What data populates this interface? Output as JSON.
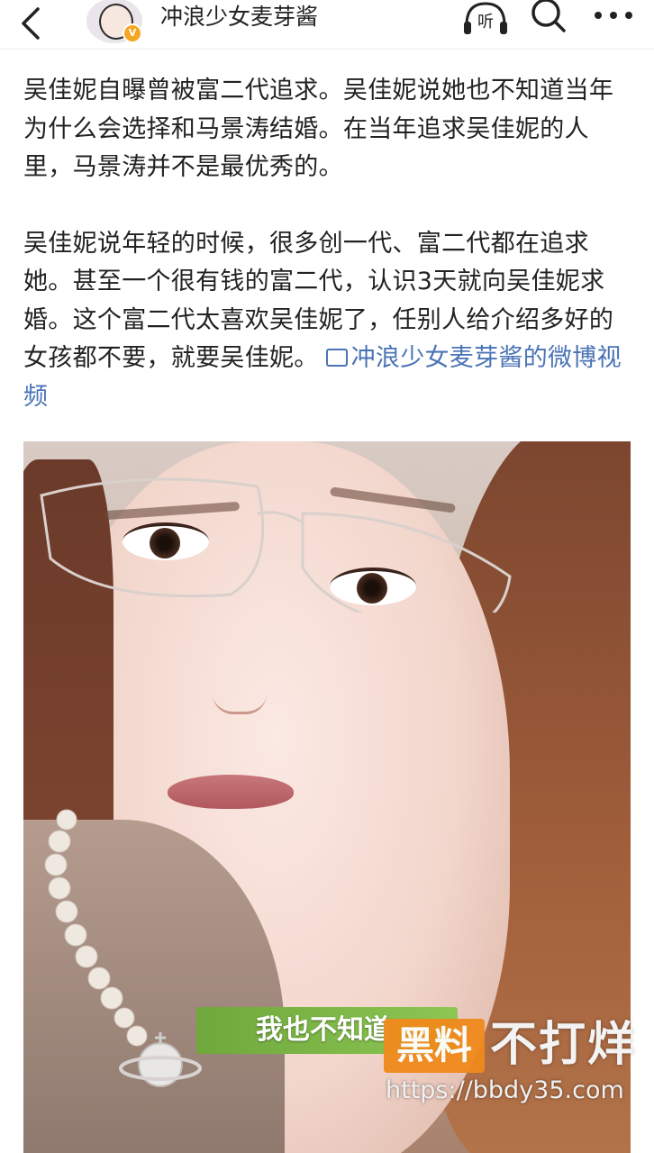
{
  "header": {
    "username": "冲浪少女麦芽酱",
    "verified_badge": "V",
    "listen_label": "听",
    "icons": [
      "back-arrow-icon",
      "listen-icon",
      "search-icon",
      "more-icon"
    ]
  },
  "article": {
    "paragraph1": "吴佳妮自曝曾被富二代追求。吴佳妮说她也不知道当年为什么会选择和马景涛结婚。在当年追求吴佳妮的人里，马景涛并不是最优秀的。",
    "paragraph2": "吴佳妮说年轻的时候，很多创一代、富二代都在追求她。甚至一个很有钱的富二代，认识3天就向吴佳妮求婚。这个富二代太喜欢吴佳妮了，任别人给介绍多好的女孩都不要，就要吴佳妮。",
    "video_link": "冲浪少女麦芽酱的微博视频"
  },
  "media": {
    "subtitle": "我也不知道"
  },
  "watermark": {
    "badge": "黑料",
    "text": "不打烊",
    "url": "https://bbdy35.com"
  },
  "colors": {
    "link": "#4a73b6",
    "subtitle_bg": "#7bb547",
    "watermark_orange": "#f08a1c",
    "verified_badge": "#f5a623"
  }
}
